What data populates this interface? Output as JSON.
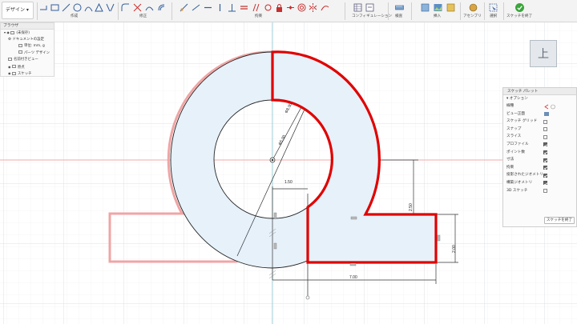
{
  "toolbar": {
    "workspace": "デザイン",
    "groups": [
      {
        "id": "create",
        "label": "作成"
      },
      {
        "id": "modify",
        "label": "修正"
      },
      {
        "id": "constraints",
        "label": "拘束"
      },
      {
        "id": "configurations",
        "label": "コンフィギュレーション"
      },
      {
        "id": "inspect",
        "label": "検査"
      },
      {
        "id": "insert",
        "label": "挿入"
      },
      {
        "id": "assemble",
        "label": "アセンブリ"
      },
      {
        "id": "select",
        "label": "選択"
      },
      {
        "id": "finish-sketch",
        "label": "スケッチを終了"
      }
    ]
  },
  "browser": {
    "title": "ブラウザ",
    "items": [
      {
        "label": "(未保存)",
        "level": 0
      },
      {
        "label": "ドキュメントの設定",
        "level": 1
      },
      {
        "label": "単位: mm, g",
        "level": 2
      },
      {
        "label": "パーツ デザイン",
        "level": 2
      },
      {
        "label": "名前付きビュー",
        "level": 1
      },
      {
        "label": "原点",
        "level": 1
      },
      {
        "label": "スケッチ",
        "level": 1
      }
    ]
  },
  "viewcube": {
    "face": "上"
  },
  "sketch_palette": {
    "title": "スケッチ パレット",
    "section": "オプション",
    "rows": [
      {
        "label": "線種",
        "type": "icon"
      },
      {
        "label": "ビュー正面",
        "type": "icon"
      },
      {
        "label": "スケッチ グリッド",
        "checked": false
      },
      {
        "label": "スナップ",
        "checked": false
      },
      {
        "label": "スライス",
        "checked": false
      },
      {
        "label": "プロファイル",
        "checked": true
      },
      {
        "label": "ポイント数",
        "checked": true
      },
      {
        "label": "寸法",
        "checked": true
      },
      {
        "label": "拘束",
        "checked": true
      },
      {
        "label": "投影されたジオメトリ",
        "checked": true
      },
      {
        "label": "構築ジオメトリ",
        "checked": true
      },
      {
        "label": "3D スケッチ",
        "checked": false
      }
    ],
    "finish_label": "スケッチを終了"
  },
  "dimensions": {
    "outer_diameter": "Φ8.00",
    "inner_diameter": "Φ5.00",
    "offset": "1.50",
    "height_a": "2.50",
    "height_b": "2.00",
    "length": "7.00"
  },
  "colors": {
    "profile_outline": "#e00000",
    "profile_fill": "#e6f1fa",
    "ghost_outline": "#f0a4a4",
    "grid_minor": "#eceef0",
    "grid_major": "#d6d9dc",
    "axis_x": "#f2aaaa",
    "axis_y": "#9fd0d8",
    "toolbar_bg": "#f3f3f3"
  }
}
